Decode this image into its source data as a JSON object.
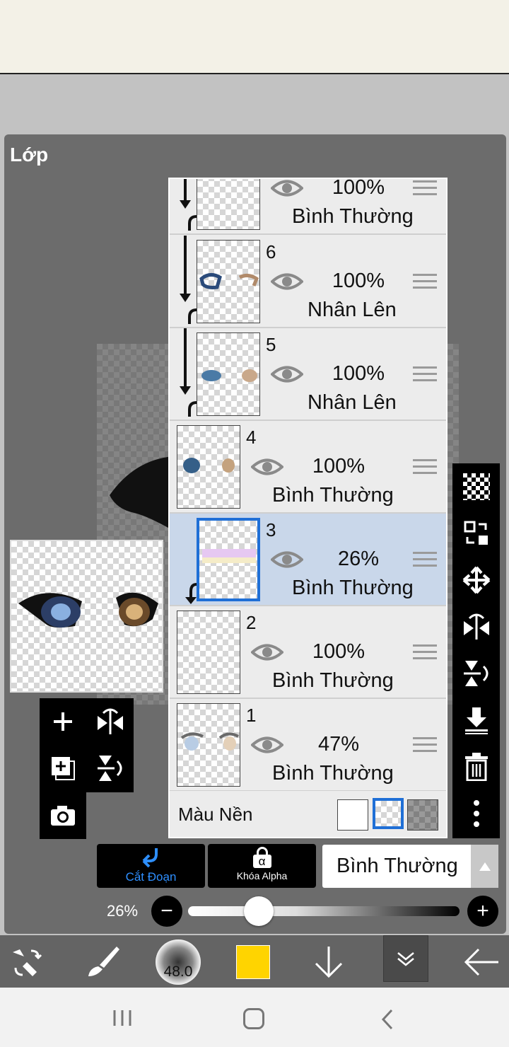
{
  "panel": {
    "title": "Lớp"
  },
  "layers": [
    {
      "number": "",
      "opacity": "100%",
      "mode": "Bình Thường",
      "clipped": true,
      "selected": false
    },
    {
      "number": "6",
      "opacity": "100%",
      "mode": "Nhân Lên",
      "clipped": true,
      "selected": false
    },
    {
      "number": "5",
      "opacity": "100%",
      "mode": "Nhân Lên",
      "clipped": true,
      "selected": false
    },
    {
      "number": "4",
      "opacity": "100%",
      "mode": "Bình Thường",
      "clipped": false,
      "selected": false
    },
    {
      "number": "3",
      "opacity": "26%",
      "mode": "Bình Thường",
      "clipped": true,
      "selected": true
    },
    {
      "number": "2",
      "opacity": "100%",
      "mode": "Bình Thường",
      "clipped": false,
      "selected": false
    },
    {
      "number": "1",
      "opacity": "47%",
      "mode": "Bình Thường",
      "clipped": false,
      "selected": false
    }
  ],
  "background_row": {
    "label": "Màu Nền"
  },
  "layer_actions": {
    "clip_label": "Cắt Đoạn",
    "alpha_lock_label": "Khóa Alpha",
    "alpha_symbol": "α",
    "blend_mode": "Bình Thường"
  },
  "opacity": {
    "label": "26%",
    "value": 0.26,
    "minus": "−",
    "plus": "+"
  },
  "brush": {
    "size": "48.0"
  },
  "colors": {
    "current": "#ffd400",
    "accent": "#1f6fd6"
  },
  "icons": {
    "right_toolbar": [
      "transparency-checker-icon",
      "layer-transform-icon",
      "move-icon",
      "flip-horizontal-icon",
      "flip-vertical-icon",
      "merge-down-icon",
      "delete-icon",
      "more-icon"
    ],
    "left_toolbar": [
      "add-layer-icon",
      "flip-rotate-icon",
      "duplicate-layer-icon",
      "flip-vertical-rotate-icon",
      "camera-icon"
    ]
  }
}
